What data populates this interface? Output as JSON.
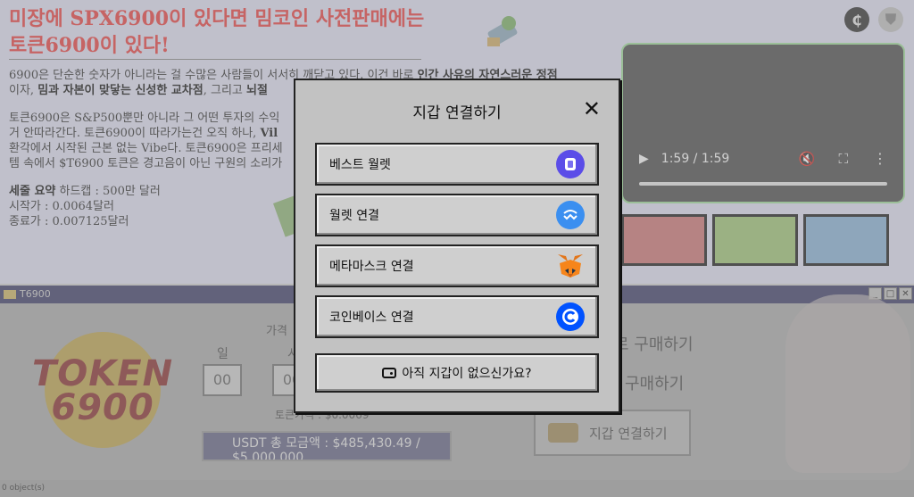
{
  "hero": {
    "title": "미장에 SPX6900이 있다면 밈코인 사전판매에는 토큰6900이 있다!",
    "para1_a": "6900은 단순한 숫자가 아니라는 걸 수많은 사람들이 서서히 깨닫고 있다. 이건 바로 ",
    "para1_b": "인간 사유의 자연스러운 정점",
    "para1_c": "이자, ",
    "para1_d": "밈과 자본이 맞닿는 신성한 교차점",
    "para1_e": ", 그리고 ",
    "para1_f": "뇌절",
    "para2_a": "토큰6900은 S&P500뿐만 아니라 그 어떤 투자의 수익",
    "para2_b": "거 안따라간다. 토큰6900이 따라가는건 오직 하나, ",
    "para2_c": "Vil",
    "para2_d": "환각에서 시작된 근본 없는 Vibe다. 토큰6900은 프리세",
    "para2_e": "템 속에서 $T6900 토큰은 경고음이 아닌 구원의 소리가",
    "hardcap_label": "세줄 요약",
    "hardcap": " 하드캡 : 500만 달러",
    "start_price": "시작가 : 0.0064달러",
    "end_price": "종료가 : 0.007125달러"
  },
  "video": {
    "time": "1:59 / 1:59",
    "progress": 1.0
  },
  "window": {
    "title": "T6900",
    "logo_line1": "TOKEN",
    "logo_line2": "6900",
    "price_label": "가격",
    "day_label": "일",
    "hour_label": "시",
    "day_value": "00",
    "hour_value": "00",
    "token_price": "토큰가격 : $0.0069",
    "raised": "USDT 총 모금액 : $485,430.49 / $5,000,000",
    "buy_label_1": "로 구매하기",
    "buy_label_2": "구매하기",
    "connect_label": "지갑 연결하기"
  },
  "status_bar": "0 object(s)",
  "modal": {
    "title": "지갑 연결하기",
    "close_icon": "close-icon",
    "wallets": [
      {
        "label": "베스트 월렛",
        "icon": "best-wallet-icon",
        "color": "#5b4de8"
      },
      {
        "label": "월렛 연결",
        "icon": "walletconnect-icon",
        "color": "#3b8ff0"
      },
      {
        "label": "메타마스크 연결",
        "icon": "metamask-fox-icon",
        "color": "#e4761b"
      },
      {
        "label": "코인베이스 연결",
        "icon": "coinbase-icon",
        "color": "#0052ff"
      }
    ],
    "no_wallet": "아직 지갑이 없으신가요?"
  }
}
